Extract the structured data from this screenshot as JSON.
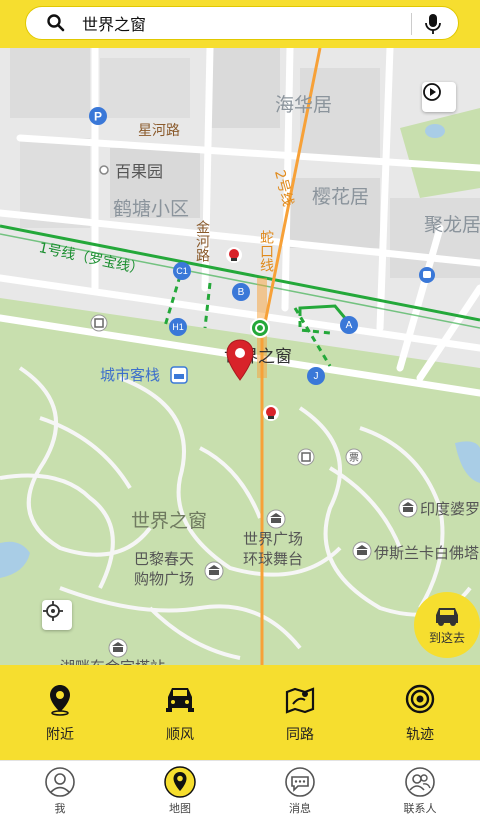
{
  "search": {
    "text": "世界之窗"
  },
  "map": {
    "labels": {
      "haihuaju": "海华居",
      "xingheroad": "星河路",
      "baiguoyuan": "百果园",
      "hetang": "鹤塘小区",
      "yinghuaju": "樱花居",
      "julongju": "聚龙居",
      "jinheroad": "金河路",
      "line2": "2号线",
      "shekouline": "蛇口线",
      "line1": "1号线（罗宝线）",
      "chengshi": "城市客栈",
      "sjzc_station": "世界之窗",
      "sjzc_park": "世界之窗",
      "yindu": "印度婆罗",
      "sjgc": "世界广场",
      "huanqiu": "环球舞台",
      "bali": "巴黎春天",
      "gouwu": "购物广场",
      "yisilan": "伊斯兰卡白佛塔",
      "bottom_cut": "湖畔东金字塔站"
    },
    "exits": {
      "c1": "C1",
      "b": "B",
      "a": "A",
      "h1": "H1",
      "j": "J"
    },
    "goto_label": "到这去"
  },
  "actions": [
    {
      "label": "附近",
      "icon": "location-pin-icon"
    },
    {
      "label": "顺风",
      "icon": "car-icon"
    },
    {
      "label": "同路",
      "icon": "route-map-icon"
    },
    {
      "label": "轨迹",
      "icon": "track-target-icon"
    }
  ],
  "nav": [
    {
      "label": "我",
      "icon": "person-icon"
    },
    {
      "label": "地图",
      "icon": "map-pin-icon",
      "active": true
    },
    {
      "label": "消息",
      "icon": "chat-icon"
    },
    {
      "label": "联系人",
      "icon": "contacts-icon"
    }
  ],
  "colors": {
    "brand_yellow": "#f6de2f",
    "metro_green": "#24a83a",
    "metro_orange": "#f7a138",
    "marker_red": "#d8232a",
    "exit_blue": "#3a78d8"
  }
}
